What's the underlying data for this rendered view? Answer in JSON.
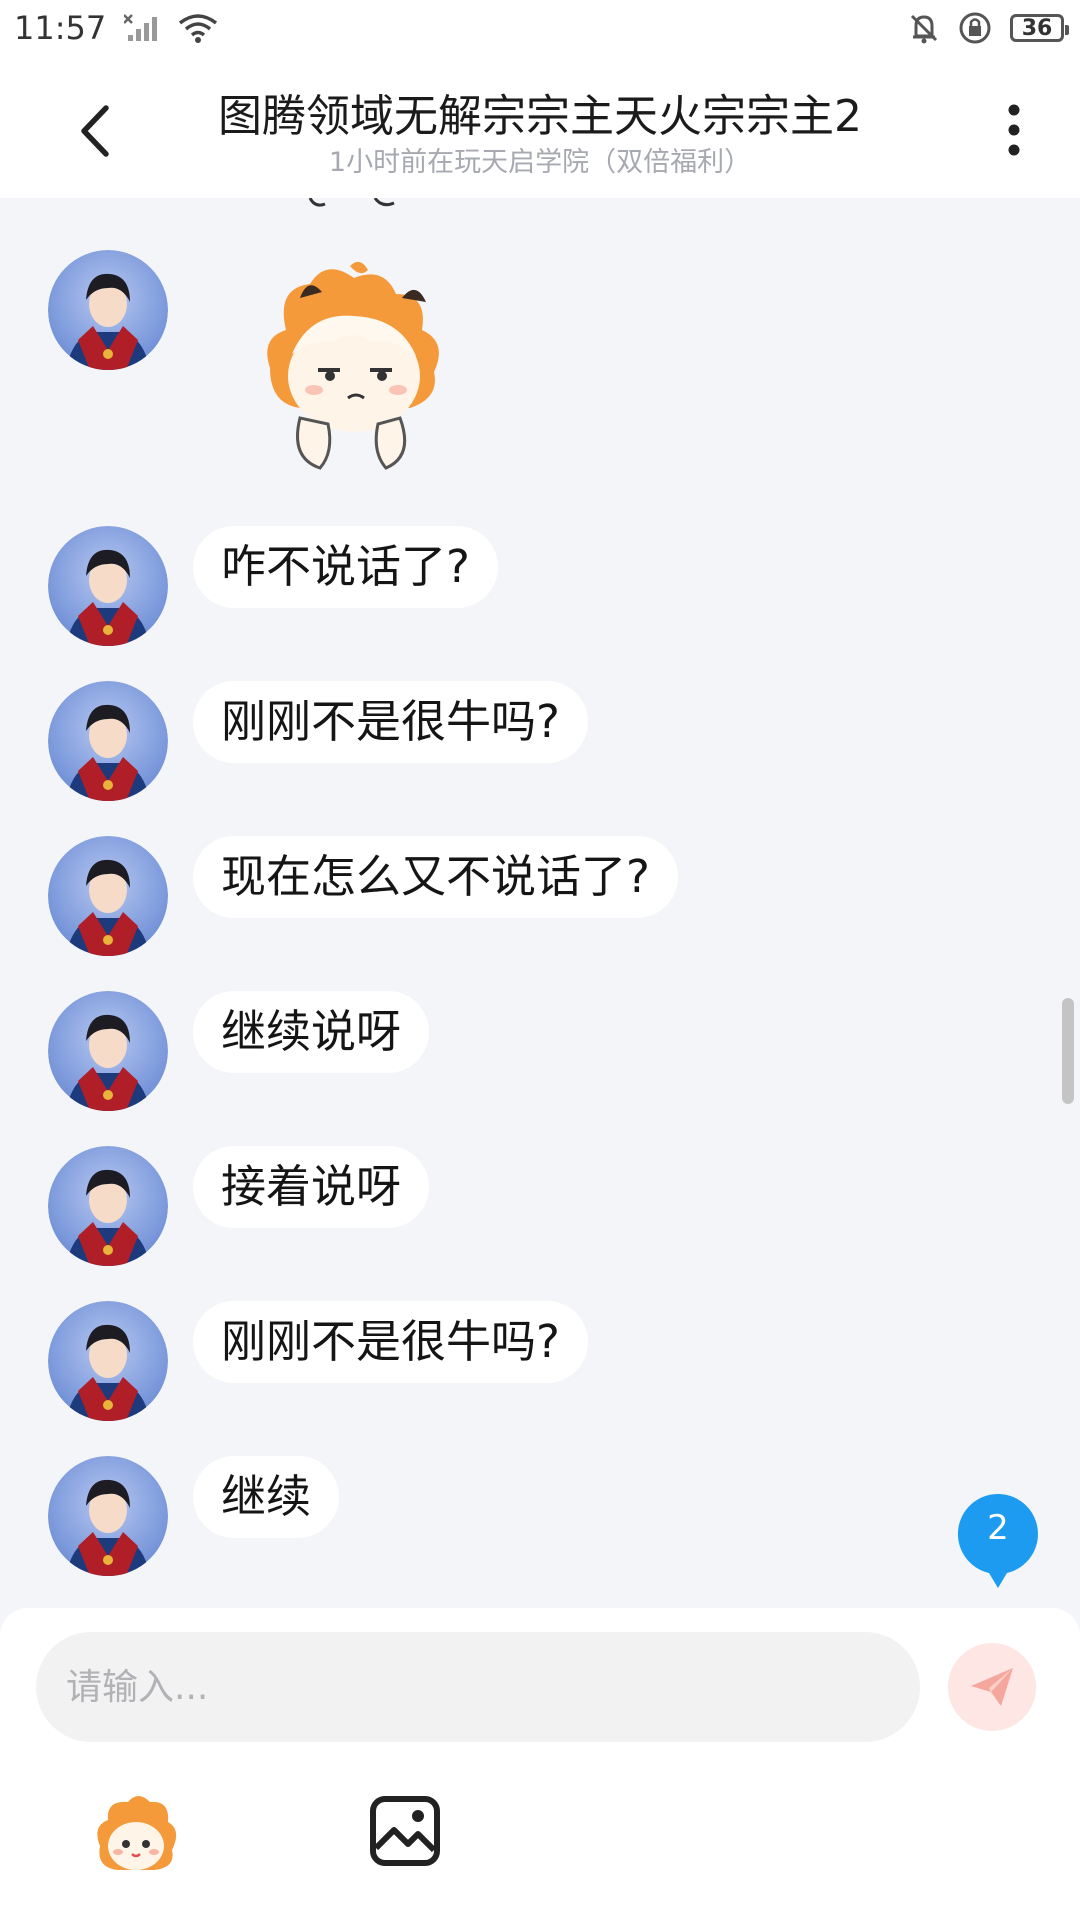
{
  "status_bar": {
    "time": "11:57",
    "battery": "36",
    "icons": [
      "signal-off-icon",
      "wifi-icon",
      "bell-mute-icon",
      "rotation-lock-icon",
      "battery-icon"
    ]
  },
  "header": {
    "title": "图腾领域无解宗宗主天火宗宗主2",
    "subtitle": "1小时前在玩天启学院（双倍福利）",
    "icons": [
      "back-arrow-icon",
      "more-vertical-icon"
    ]
  },
  "chat": {
    "messages": [
      {
        "type": "sticker",
        "sticker": "annoyed-anime-girl-sticker"
      },
      {
        "type": "text",
        "text": "咋不说话了?"
      },
      {
        "type": "text",
        "text": "刚刚不是很牛吗?"
      },
      {
        "type": "text",
        "text": "现在怎么又不说话了?"
      },
      {
        "type": "text",
        "text": "继续说呀"
      },
      {
        "type": "text",
        "text": "接着说呀"
      },
      {
        "type": "text",
        "text": "刚刚不是很牛吗?"
      },
      {
        "type": "text",
        "text": "继续"
      }
    ],
    "unread_count": "2"
  },
  "composer": {
    "placeholder": "请输入...",
    "value": "",
    "icons": [
      "send-paper-plane-icon",
      "emoji-sticker-icon",
      "image-icon"
    ]
  },
  "colors": {
    "background": "#f4f5f9",
    "bubble": "#ffffff",
    "badge": "#1d9bf0",
    "send_button": "#fde6e3",
    "send_icon": "#f6a79d"
  }
}
